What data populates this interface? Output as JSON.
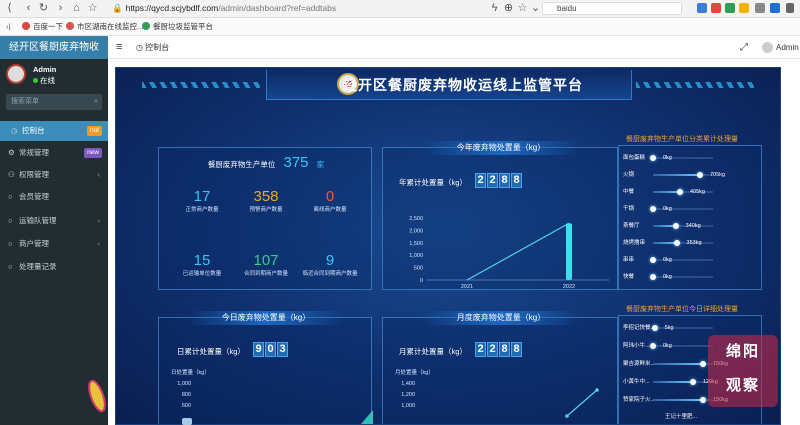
{
  "browser": {
    "url_prefix": "https://",
    "url_host": "qycd.scjybdlf.com",
    "url_path": "/admin/dashboard?ref=addtabs",
    "search_text": "baidu",
    "bookmarks": [
      "百度一下",
      "市区湖南在线监控...",
      "餐厨垃圾监管平台"
    ]
  },
  "sidebar": {
    "logo": "经开区餐厨废弃物收",
    "user_name": "Admin",
    "user_status": "在线",
    "search_placeholder": "搜索菜单",
    "items": [
      {
        "label": "控制台",
        "badge": "hot",
        "badge_color": "#f39c12",
        "icon": "dashboard-icon",
        "glyph": "◷"
      },
      {
        "label": "常规管理",
        "badge": "new",
        "badge_color": "#7e57c2",
        "icon": "gear-icon",
        "glyph": "⚙"
      },
      {
        "label": "权限管理",
        "icon": "group-icon",
        "glyph": "⚇"
      },
      {
        "label": "会员管理",
        "icon": "circle-icon",
        "glyph": "○"
      },
      {
        "label": "运输队管理",
        "icon": "circle-icon",
        "glyph": "○"
      },
      {
        "label": "商户管理",
        "icon": "circle-icon",
        "glyph": "○"
      },
      {
        "label": "处理量记录",
        "icon": "circle-icon",
        "glyph": "○"
      }
    ]
  },
  "topnav": {
    "tab": "控制台",
    "user": "Admin"
  },
  "dashboard": {
    "title": "经开区餐厨废弃物收运线上监管平台",
    "units_panel": {
      "heading": "餐厨废弃物生产单位",
      "heading_value": "375",
      "heading_unit": "家",
      "stats": [
        {
          "value": "17",
          "label": "正常商户数量",
          "color": "#38c6f4"
        },
        {
          "value": "358",
          "label": "预警商户数量",
          "color": "#f5a623"
        },
        {
          "value": "0",
          "label": "离线商户数量",
          "color": "#f5533d"
        },
        {
          "value": "15",
          "label": "已运输单位数量",
          "color": "#38c6f4"
        },
        {
          "value": "107",
          "label": "合同到期商户数量",
          "color": "#35d07f"
        },
        {
          "value": "9",
          "label": "临近合同到期商户数量",
          "color": "#38c6f4"
        }
      ]
    },
    "year_panel": {
      "title": "今年废弃物处置量（kg）",
      "label": "年累计处置量（kg）",
      "digits": [
        "2",
        "2",
        "8",
        "8"
      ],
      "yticks": [
        "2,500",
        "2,000",
        "1,500",
        "1,000",
        "500",
        "0"
      ],
      "xticks": [
        "2021",
        "2022"
      ]
    },
    "category_panel": {
      "title": "餐厨废弃物生产单位分类累计处理量",
      "rows": [
        {
          "name": "面包蛋糕",
          "value": "0kg",
          "pct": 0.0
        },
        {
          "name": "火锅",
          "value": "705kg",
          "pct": 0.0
        },
        {
          "name": "中餐",
          "value": "405kg",
          "pct": 0.0
        },
        {
          "name": "干锅",
          "value": "0kg",
          "pct": 0.0
        },
        {
          "name": "茶餐厅",
          "value": "340kg",
          "pct": 0.0
        },
        {
          "name": "烧烤撸串",
          "value": "353kg",
          "pct": 0.0
        },
        {
          "name": "串串",
          "value": "0kg",
          "pct": 0.0
        },
        {
          "name": "快餐",
          "value": "0kg",
          "pct": 0.0
        }
      ]
    },
    "today_panel": {
      "title": "今日废弃物处置量（kg）",
      "label": "日累计处置量（kg）",
      "digits": [
        "9",
        "0",
        "3"
      ],
      "unit_label": "日处置量（kg）",
      "yticks": [
        "1,000",
        "800",
        "600"
      ]
    },
    "month_panel": {
      "title": "月度废弃物处置量（kg）",
      "label": "月累计处置量（kg）",
      "digits": [
        "2",
        "2",
        "8",
        "8"
      ],
      "unit_label": "月处置量（kg）",
      "yticks": [
        "1,400",
        "1,200",
        "1,000"
      ]
    },
    "daily_detail_panel": {
      "title": "餐厨废弃物生产单位今日详细处理量",
      "rows": [
        {
          "name": "李招记快餐...",
          "value": "5kg",
          "pct": 0.0
        },
        {
          "name": "阿玮小牛...",
          "value": "0kg",
          "pct": 0.0
        },
        {
          "name": "聚吉源鲜米...",
          "value": "150kg",
          "pct": 0.0
        },
        {
          "name": "小黄牛中...",
          "value": "120kg",
          "pct": 0.0
        },
        {
          "name": "赞家院子火...",
          "value": "150kg",
          "pct": 0.0
        }
      ],
      "partial_label": "王记十里肥..."
    },
    "watermark": [
      "绵阳",
      "观察"
    ]
  },
  "chart_data": {
    "type": "line",
    "title": "今年废弃物处置量（kg）",
    "categories": [
      "2021",
      "2022"
    ],
    "values": [
      0,
      2288
    ],
    "ylim": [
      0,
      2500
    ]
  }
}
